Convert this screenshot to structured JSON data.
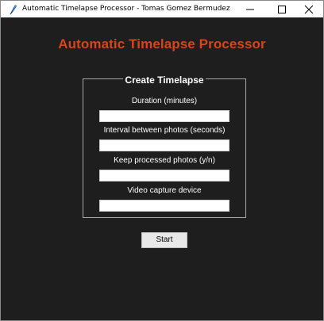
{
  "window": {
    "title": "Automatic Timelapse Processor - Tomas Gomez Bermudez",
    "controls": [
      "minimize-icon",
      "maximize-icon",
      "close-icon"
    ],
    "icon": "feather-icon"
  },
  "main": {
    "heading": "Automatic Timelapse Processor",
    "heading_color": "#d9441c",
    "background_color": "#1e1e1e"
  },
  "form": {
    "legend": "Create Timelapse",
    "fields": [
      {
        "label": "Duration (minutes)",
        "value": ""
      },
      {
        "label": "Interval between photos (seconds)",
        "value": ""
      },
      {
        "label": "Keep processed photos (y/n)",
        "value": ""
      },
      {
        "label": "Video capture device",
        "value": ""
      }
    ],
    "start_label": "Start"
  }
}
